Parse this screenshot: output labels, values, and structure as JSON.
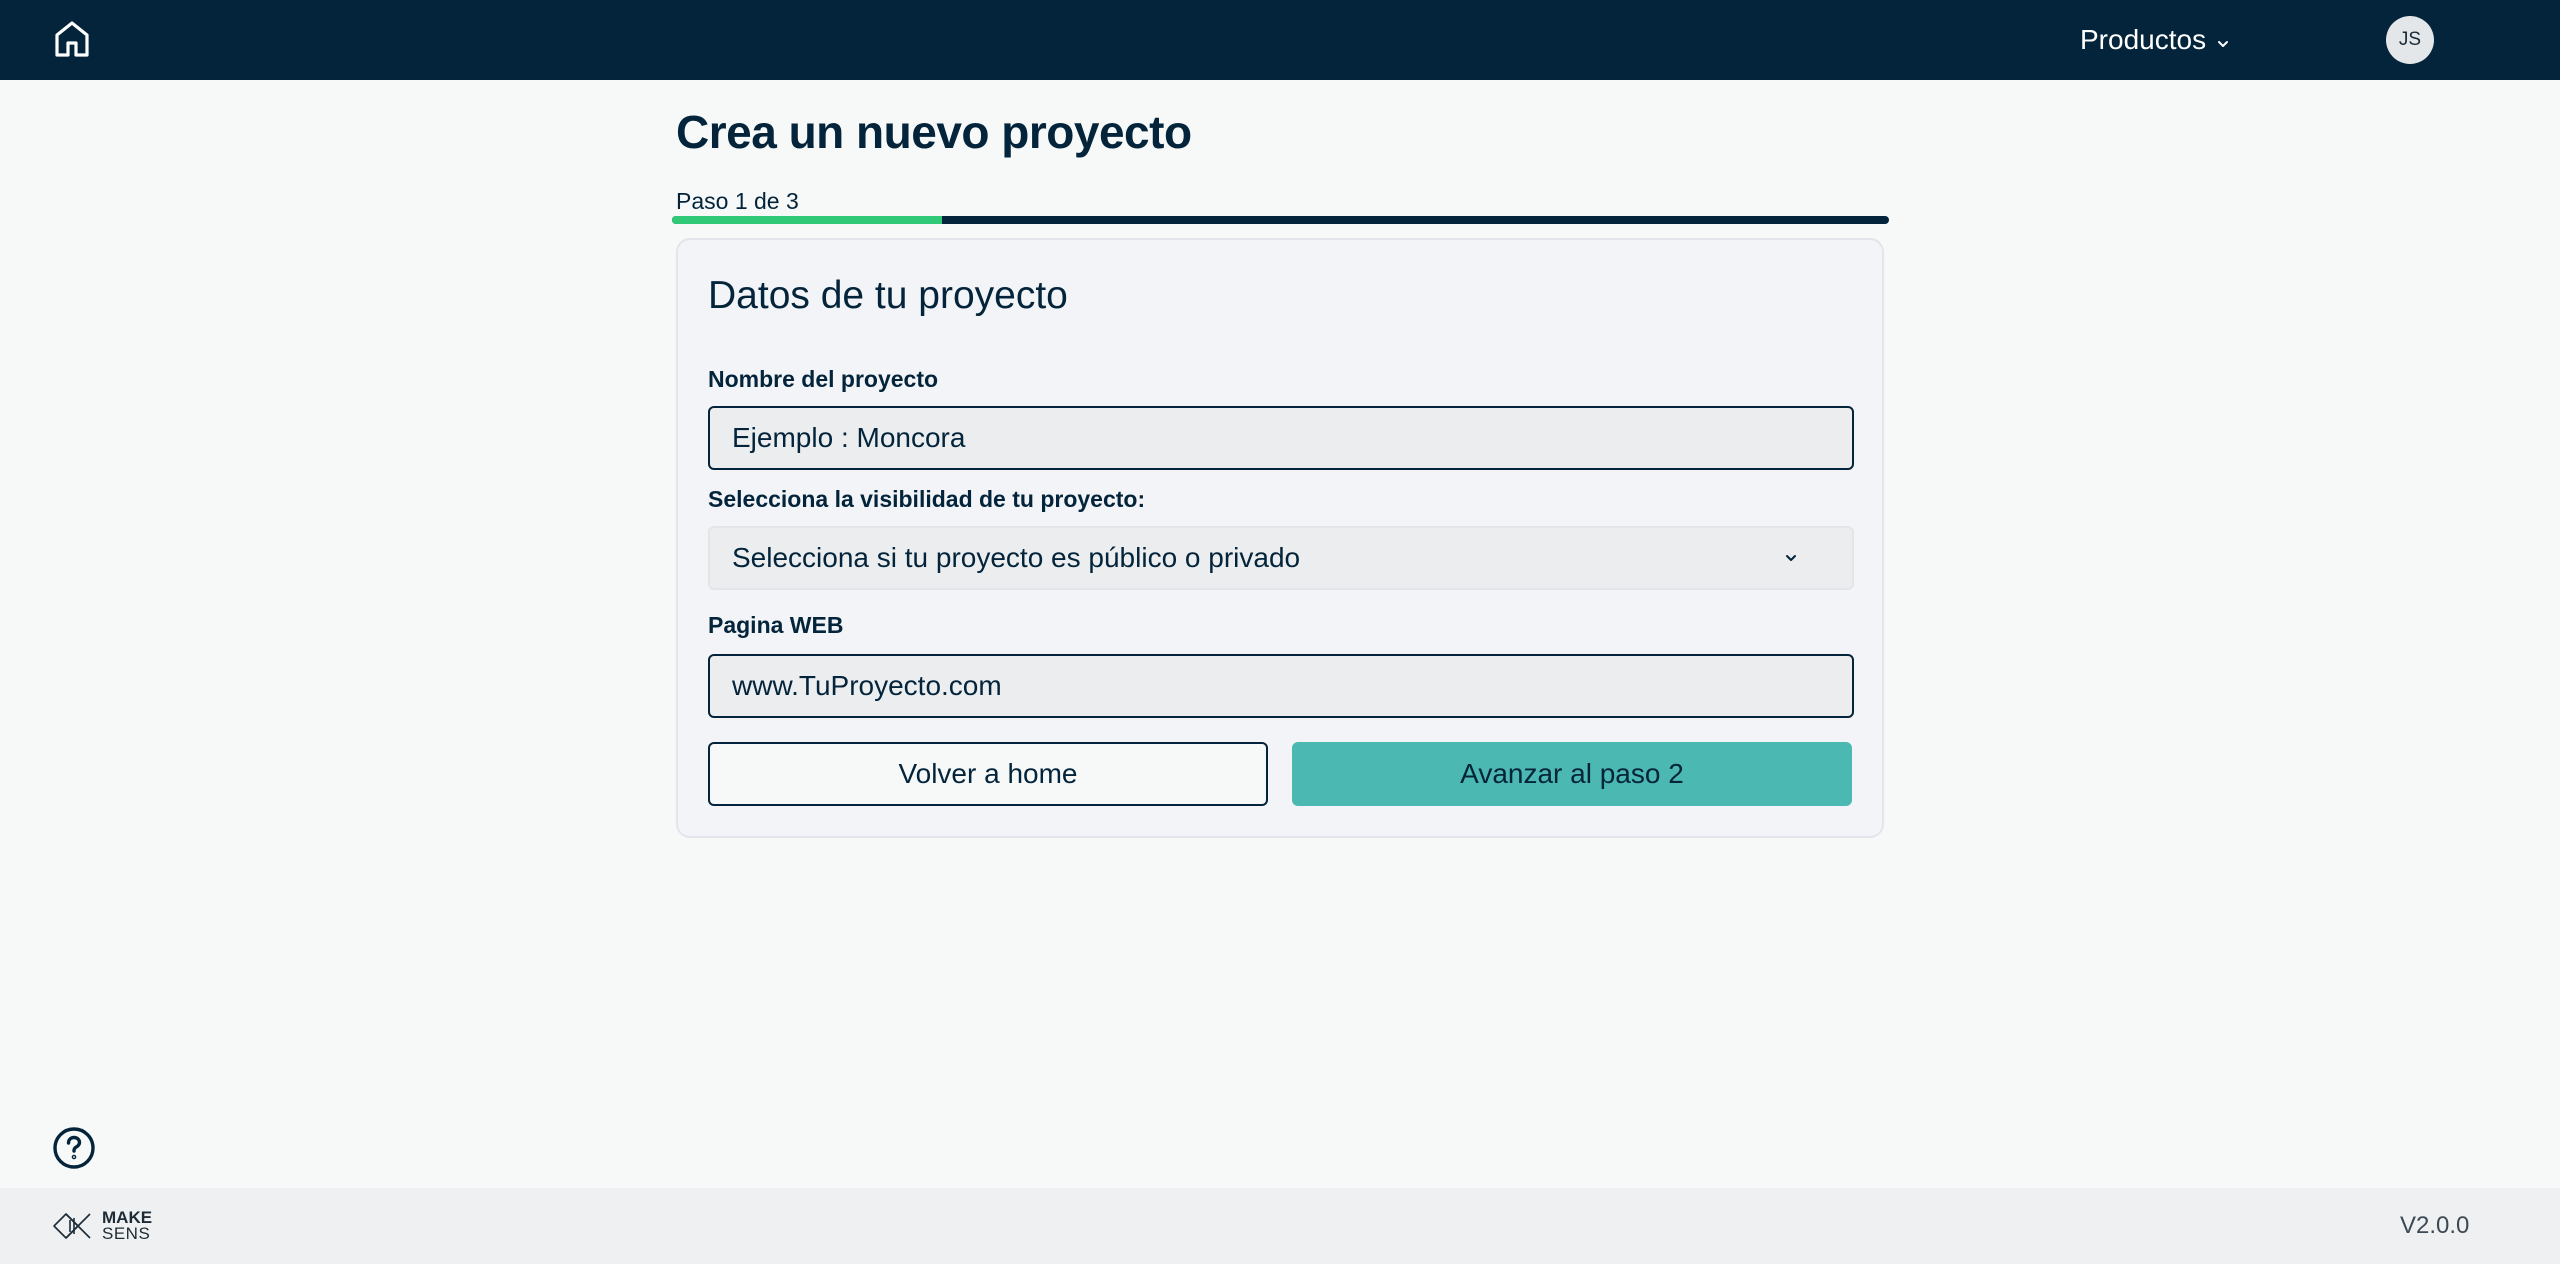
{
  "header": {
    "home_icon": "home-icon",
    "products_label": "Productos",
    "products_icon": "chevron-down-icon",
    "avatar_initials": "JS"
  },
  "main": {
    "title": "Crea un nuevo proyecto",
    "step_label": "Paso 1 de 3",
    "progress": {
      "current_step": 1,
      "total_steps": 3,
      "fraction": 0.222
    },
    "colors": {
      "accent": "#2fc977",
      "primary": "#03243a",
      "button_primary": "#4bb8b2"
    }
  },
  "card": {
    "title": "Datos de tu proyecto",
    "name_field": {
      "label": "Nombre del proyecto",
      "placeholder": "Ejemplo : Moncora"
    },
    "visibility_field": {
      "label": "Selecciona la visibilidad de tu proyecto:",
      "selected": "Selecciona si tu proyecto es público o privado"
    },
    "web_field": {
      "label": "Pagina WEB",
      "placeholder": "www.TuProyecto.com"
    },
    "back_button": "Volver a home",
    "next_button": "Avanzar al paso 2"
  },
  "help": {
    "icon": "help-circle-icon"
  },
  "footer": {
    "logo_line1": "MAKE",
    "logo_line2": "SENS",
    "version": "V2.0.0"
  }
}
